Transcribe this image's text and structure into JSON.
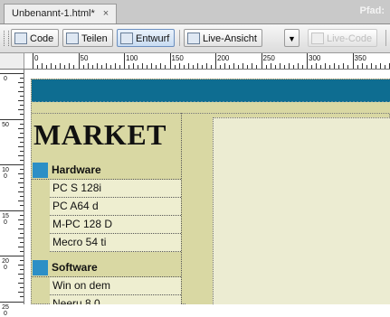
{
  "document_tab": {
    "title": "Unbenannt-1.html*",
    "close": "×"
  },
  "path_label": "Pfad:",
  "toolbar": {
    "code": "Code",
    "split": "Teilen",
    "design": "Entwurf",
    "live_view": "Live-Ansicht",
    "live_code": "Live-Code"
  },
  "ruler": {
    "h_labels": [
      "0",
      "50",
      "100",
      "150",
      "200",
      "250",
      "300",
      "350"
    ],
    "v_labels": [
      "0",
      "50",
      "100",
      "150",
      "200",
      "250"
    ]
  },
  "page": {
    "logo": "MARKET",
    "categories": [
      {
        "name": "Hardware",
        "items": [
          "PC S 128i",
          "PC A64 d",
          "M-PC 128 D",
          "Mecro 54 ti"
        ]
      },
      {
        "name": "Software",
        "items": [
          "Win on dem",
          "Neeru 8.0"
        ]
      }
    ]
  },
  "colors": {
    "banner": "#0e6d91",
    "sidebar_bg": "#d9d8a3",
    "category_square": "#2c8fc6",
    "content_bg": "#ececd2"
  }
}
